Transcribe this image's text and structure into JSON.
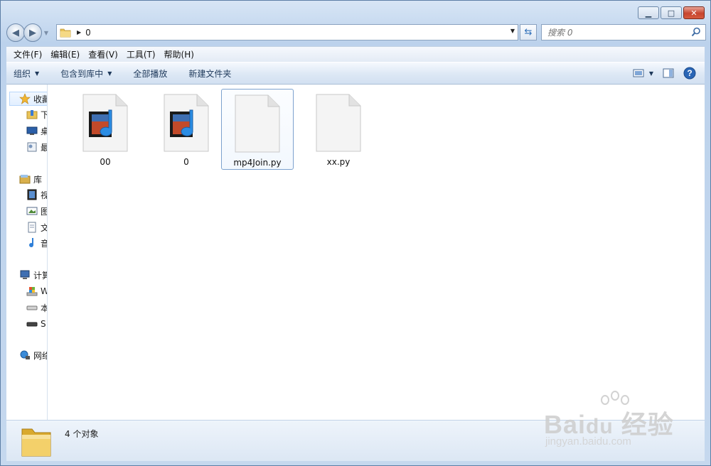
{
  "window": {
    "title_buttons": [
      "minimize",
      "maximize",
      "close"
    ]
  },
  "address_bar": {
    "crumb": "0",
    "search_placeholder": "搜索 0"
  },
  "menu": {
    "items": [
      "文件(F)",
      "编辑(E)",
      "查看(V)",
      "工具(T)",
      "帮助(H)"
    ]
  },
  "toolbar": {
    "organize": "组织",
    "include_library": "包含到库中",
    "play_all": "全部播放",
    "new_folder": "新建文件夹"
  },
  "nav_pane": {
    "favorites": "收藏",
    "fav_items": [
      "下",
      "桌",
      "最"
    ],
    "libraries": "库",
    "lib_items": [
      "视",
      "图",
      "文",
      "音"
    ],
    "computer": "计算",
    "comp_items": [
      "W",
      "本",
      "S"
    ],
    "network": "网络"
  },
  "files": [
    {
      "name": "00",
      "type": "video",
      "icon": "media-file-icon"
    },
    {
      "name": "0",
      "type": "video",
      "icon": "media-file-icon"
    },
    {
      "name": "mp4Join.py",
      "type": "blank",
      "icon": "blank-file-icon",
      "selected": true
    },
    {
      "name": "xx.py",
      "type": "blank",
      "icon": "blank-file-icon"
    }
  ],
  "details": {
    "count_text": "4 个对象"
  },
  "watermark": {
    "brand": "Bai du 经验",
    "url": "jingyan.baidu.com"
  },
  "colors": {
    "frame": "#bcd2ec",
    "toolbar_text": "#1e395b",
    "selection_border": "#7da2ce"
  }
}
